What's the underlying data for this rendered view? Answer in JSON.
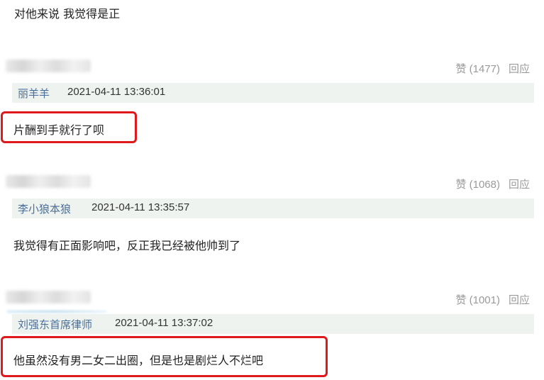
{
  "top_text": "对他来说 我觉得是正",
  "comments": [
    {
      "likes": "赞 (1477)",
      "reply_label": "回应",
      "quote_user": "丽羊羊",
      "quote_time": "2021-04-11 13:36:01",
      "text": "片酬到手就行了呗",
      "highlighted": true
    },
    {
      "likes": "赞 (1068)",
      "reply_label": "回应",
      "quote_user": "李小狼本狼",
      "quote_time": "2021-04-11 13:35:57",
      "text": "我觉得有正面影响吧，反正我已经被他帅到了",
      "highlighted": false
    },
    {
      "likes": "赞 (1001)",
      "reply_label": "回应",
      "quote_user": "刘强东首席律师",
      "quote_time": "2021-04-11 13:37:02",
      "text": "他虽然没有男二女二出圈，但是也是剧烂人不烂吧",
      "highlighted": true
    }
  ],
  "colors": {
    "highlight_border": "#e0191c",
    "quote_bg": "#eef3f0",
    "username": "#4a6f9a"
  }
}
